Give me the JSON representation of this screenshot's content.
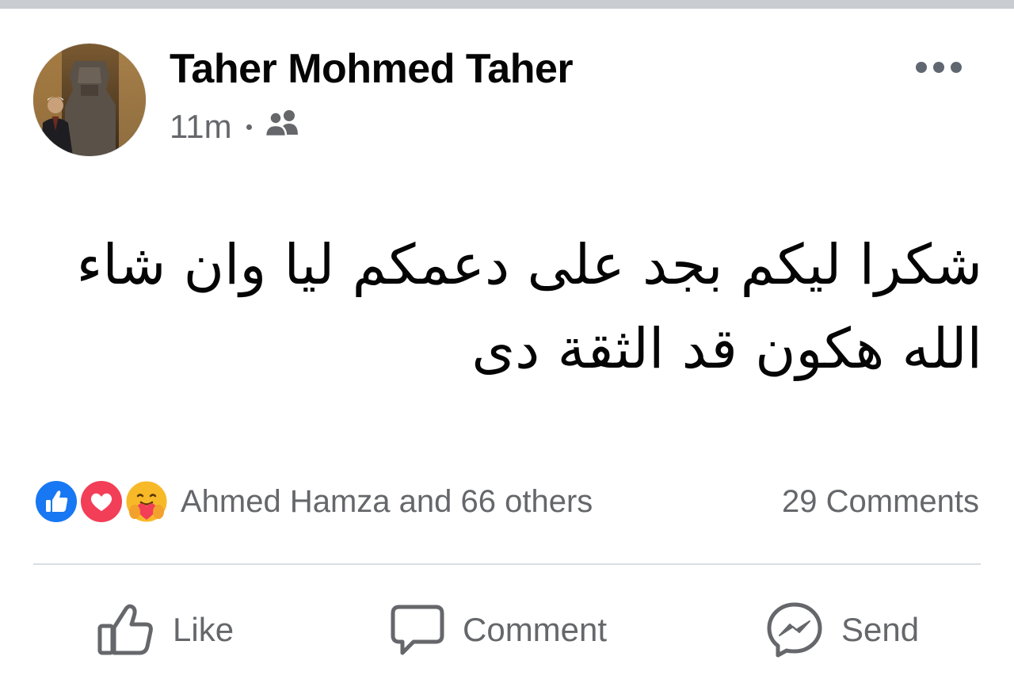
{
  "post": {
    "author": "Taher Mohmed Taher",
    "time": "11m",
    "audience_icon": "friends-icon",
    "text_lines": [
      "شكرا ليكم بجد على دعمكم ليا وان شاء",
      "الله هكون قد الثقة دى"
    ],
    "reactions": {
      "icons": [
        "like-reaction-icon",
        "love-reaction-icon",
        "care-reaction-icon"
      ],
      "summary": "Ahmed Hamza and 66 others"
    },
    "comments_count": "29 Comments"
  },
  "actions": {
    "like": "Like",
    "comment": "Comment",
    "send": "Send"
  },
  "colors": {
    "text_primary": "#050505",
    "text_secondary": "#65676b",
    "like_blue": "#1877f2",
    "love_red": "#f33e58",
    "care_yellow": "#f7b928",
    "divider": "#dadde1",
    "top_strip": "#c9ccd1"
  }
}
